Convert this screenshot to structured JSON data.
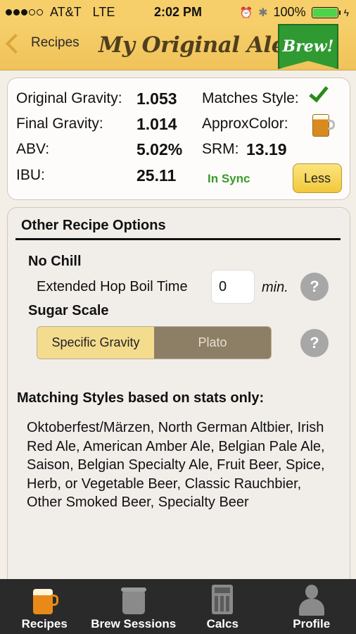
{
  "status": {
    "carrier": "AT&T",
    "network": "LTE",
    "time": "2:02 PM",
    "battery": "100%",
    "signal_bars_filled": 3,
    "signal_bars_total": 5
  },
  "nav": {
    "back_label": "Recipes",
    "title": "My Original Ale",
    "brew_label": "Brew!"
  },
  "stats": {
    "og_label": "Original Gravity:",
    "og_value": "1.053",
    "fg_label": "Final Gravity:",
    "fg_value": "1.014",
    "abv_label": "ABV:",
    "abv_value": "5.02%",
    "ibu_label": "IBU:",
    "ibu_value": "25.11",
    "matches_label": "Matches Style:",
    "color_label": "ApproxColor:",
    "srm_label": "SRM:",
    "srm_value": "13.19",
    "sync_status": "In Sync",
    "less_label": "Less"
  },
  "options": {
    "title": "Other Recipe Options",
    "no_chill": "No Chill",
    "hop_boil_label": "Extended Hop Boil Time",
    "hop_boil_value": "0",
    "hop_boil_unit": "min.",
    "help_glyph": "?",
    "sugar_scale": "Sugar Scale",
    "sugar_options": [
      "Specific Gravity",
      "Plato"
    ],
    "sugar_selected": "Specific Gravity"
  },
  "matching": {
    "title": "Matching Styles based on stats only:",
    "text": "Oktoberfest/Märzen, North German Altbier, Irish Red Ale, American Amber Ale, Belgian Pale Ale, Saison, Belgian Specialty Ale, Fruit Beer, Spice, Herb, or Vegetable Beer, Classic Rauchbier, Other Smoked Beer, Specialty Beer"
  },
  "tabs": [
    {
      "label": "Recipes",
      "icon": "beer-mug-icon",
      "active": true
    },
    {
      "label": "Brew Sessions",
      "icon": "brew-pot-icon",
      "active": false
    },
    {
      "label": "Calcs",
      "icon": "calculator-icon",
      "active": false
    },
    {
      "label": "Profile",
      "icon": "person-icon",
      "active": false
    }
  ],
  "colors": {
    "header": "#f6cf6a",
    "brew_green": "#2f9a32",
    "sync_green": "#3a9a2a",
    "active_segment": "#f4dc8e",
    "inactive_segment": "#8d7f66",
    "tabbar": "#2a2a2a"
  }
}
